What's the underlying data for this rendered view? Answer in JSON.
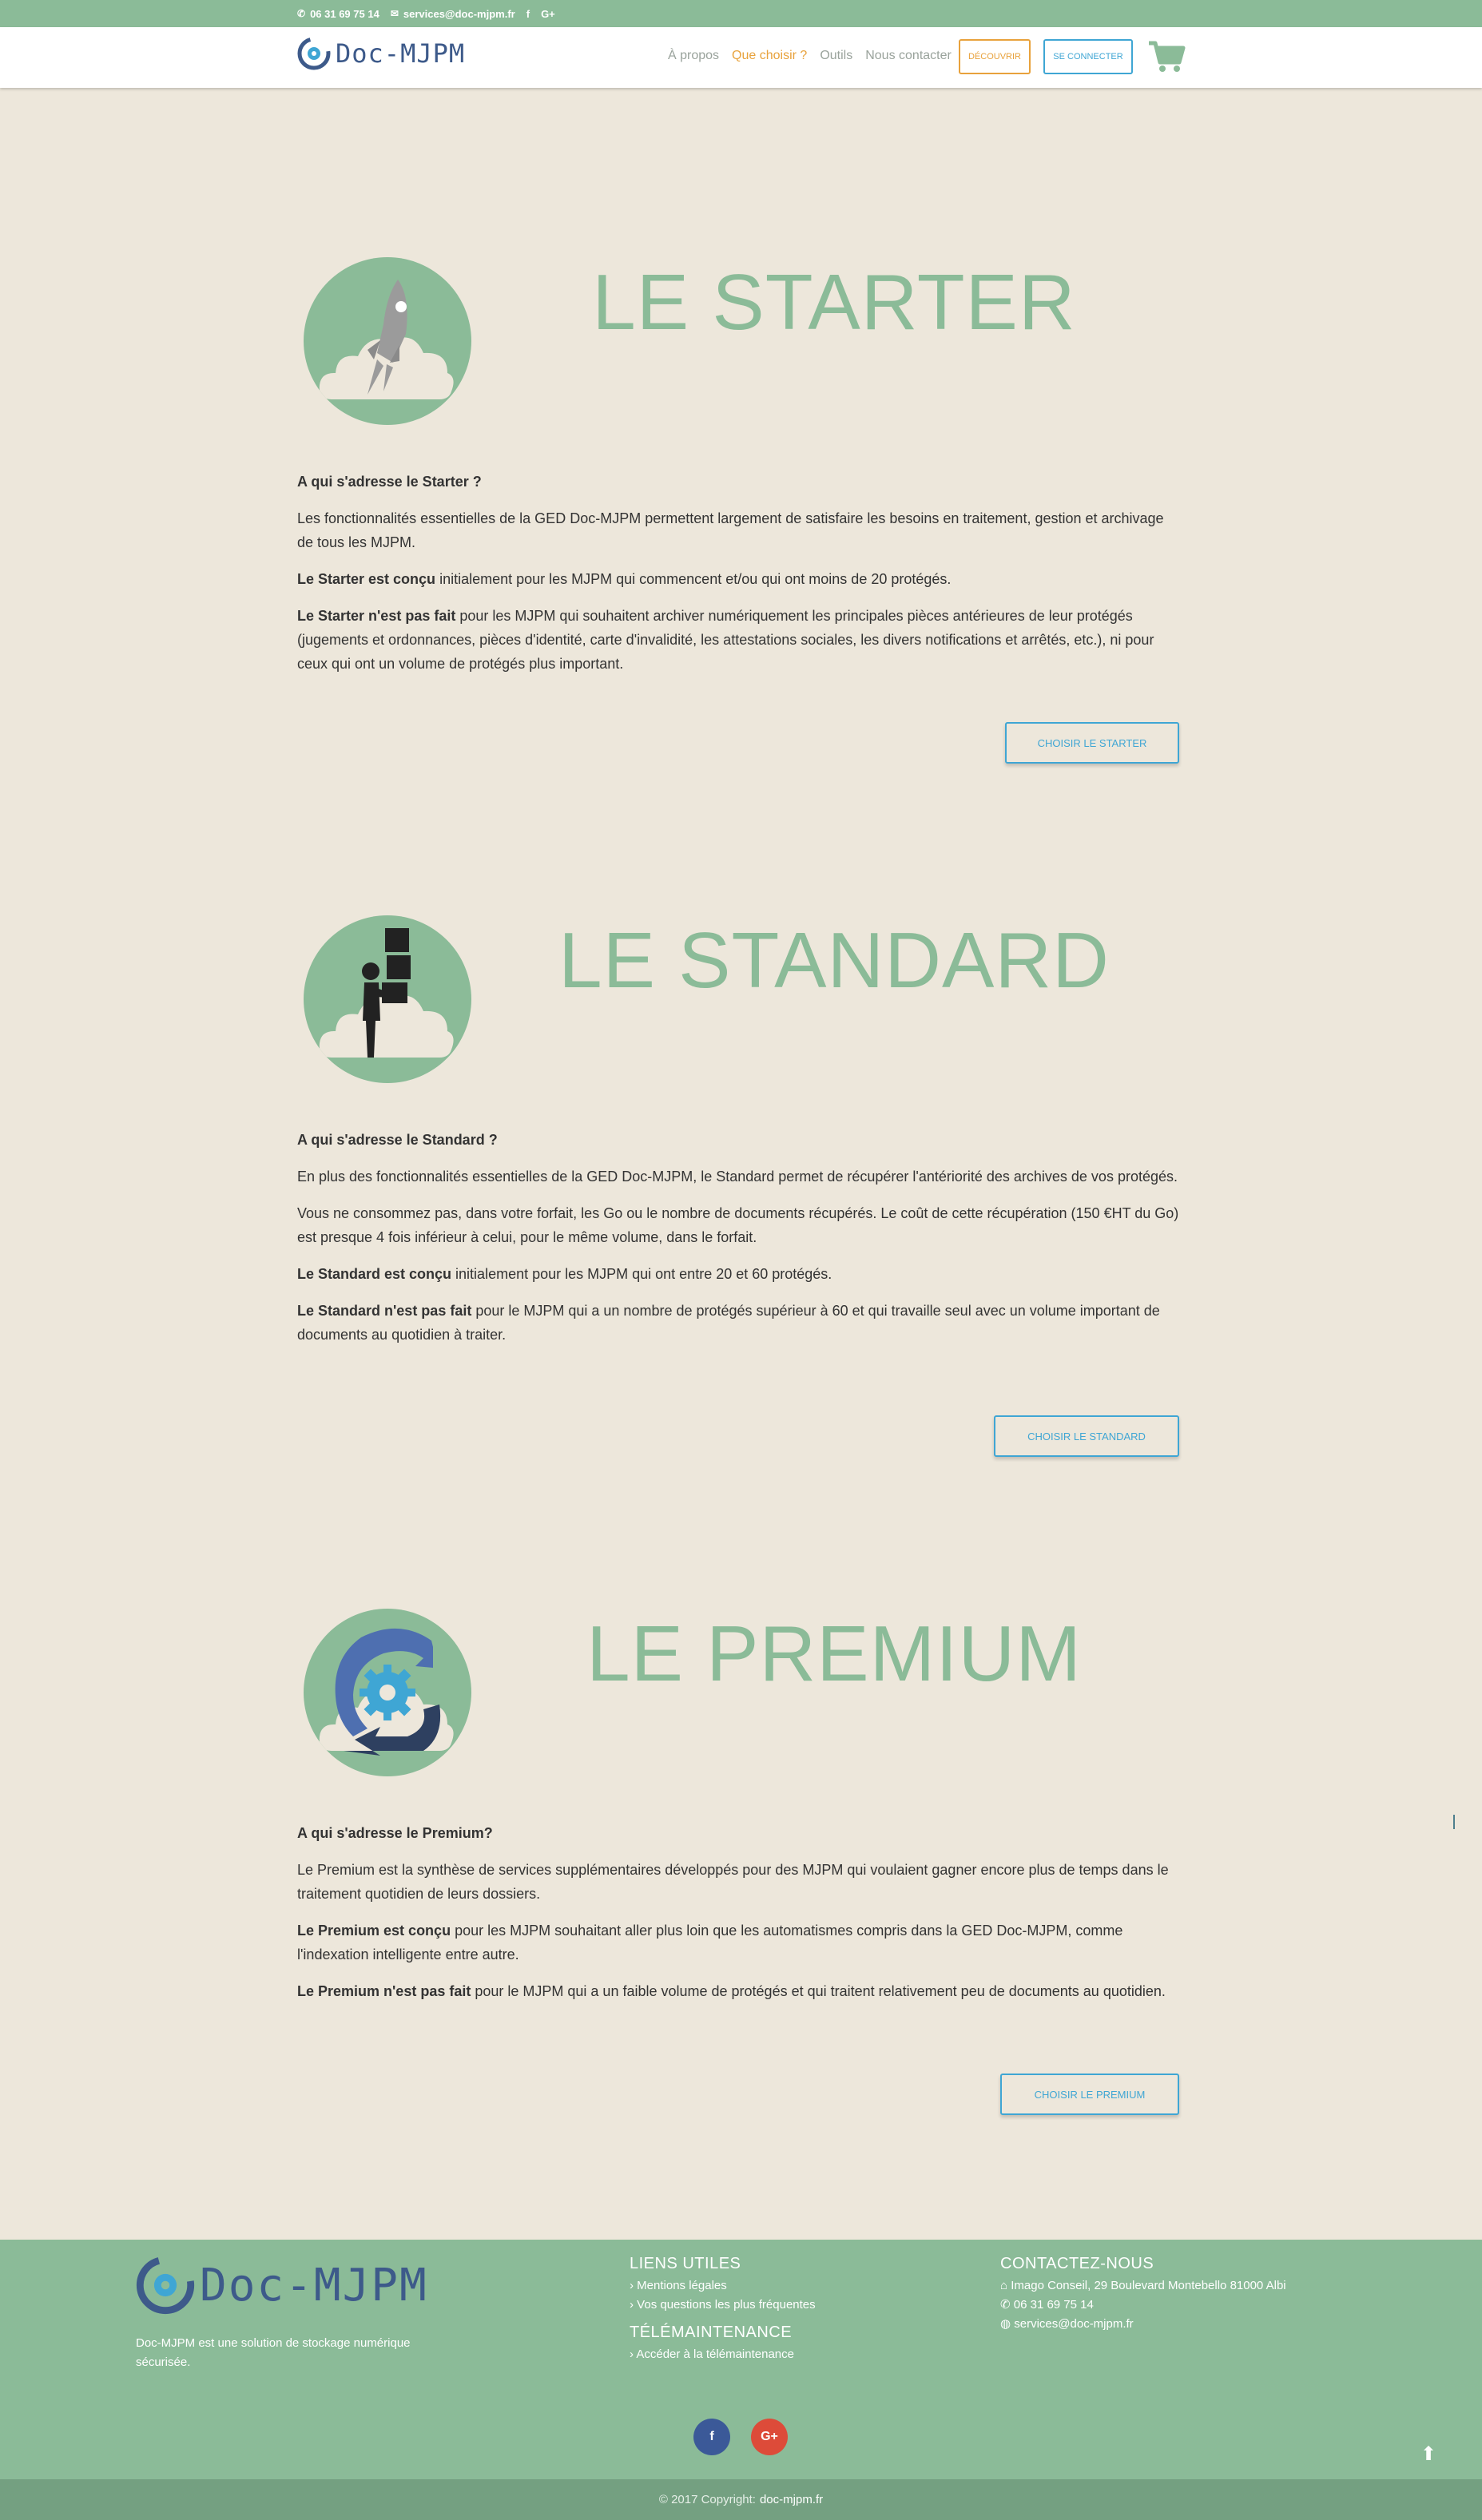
{
  "topbar": {
    "phone": "06 31 69 75 14",
    "email": "services@doc-mjpm.fr",
    "facebook": "f",
    "googleplus": "G+"
  },
  "nav": {
    "logo": "Doc-MJPM",
    "links": [
      "À propos",
      "Que choisir ?",
      "Outils",
      "Nous contacter"
    ],
    "active_index": 1,
    "discover": "DÉCOUVRIR",
    "connect": "SE CONNECTER"
  },
  "plans": [
    {
      "title": "LE STARTER",
      "icon": "rocket-cloud-icon",
      "question": "A qui s'adresse le Starter ?",
      "p1": "Les fonctionnalités essentielles de la GED Doc-MJPM permettent largement de satisfaire les besoins en traitement, gestion et archivage de tous les MJPM.",
      "p2_bold": "Le Starter est conçu",
      "p2_rest": " initialement pour les MJPM qui commencent et/ou qui ont moins de 20 protégés.",
      "p3_bold": "Le Starter n'est pas fait",
      "p3_rest": " pour les MJPM qui souhaitent archiver numériquement les principales pièces antérieures de leur protégés (jugements et ordonnances, pièces d'identité, carte d'invalidité, les attestations sociales, les divers notifications et arrêtés, etc.), ni pour ceux qui ont un volume de protégés plus important.",
      "button": "CHOISIR LE STARTER"
    },
    {
      "title": "LE STANDARD",
      "icon": "person-boxes-cloud-icon",
      "question": "A qui s'adresse le Standard ?",
      "p1": "En plus des fonctionnalités essentielles de la GED Doc-MJPM, le Standard permet de récupérer l'antériorité des archives de vos protégés.",
      "p2": "Vous ne consommez pas, dans votre forfait, les Go ou le nombre de documents récupérés. Le coût de cette récupération (150 €HT du Go) est presque 4 fois inférieur à celui, pour le même volume, dans le forfait.",
      "p3_bold": "Le Standard est conçu",
      "p3_rest": " initialement pour les MJPM qui ont entre 20 et 60 protégés.",
      "p4_bold": "Le Standard n'est pas fait",
      "p4_rest": " pour le MJPM qui a un nombre de protégés supérieur à 60 et qui travaille seul avec un volume important de documents au quotidien à traiter.",
      "button": "CHOISIR LE STANDARD"
    },
    {
      "title": "LE PREMIUM",
      "icon": "gear-sync-cloud-icon",
      "question": "A qui s'adresse le Premium?",
      "p1": "Le Premium est la synthèse de services supplémentaires développés pour des MJPM qui voulaient gagner encore plus de temps dans le traitement quotidien de leurs dossiers.",
      "p2_bold": "Le Premium est conçu",
      "p2_rest": " pour les MJPM souhaitant aller plus loin que les automatismes compris dans la GED Doc-MJPM, comme l'indexation intelligente entre autre.",
      "p3_bold": "Le Premium n'est pas fait",
      "p3_rest": " pour le MJPM qui a un faible volume de protégés et qui traitent relativement peu de documents au quotidien.",
      "button": "CHOISIR LE PREMIUM"
    }
  ],
  "footer": {
    "logo": "Doc-MJPM",
    "description": "Doc-MJPM est une solution de stockage numérique sécurisée.",
    "links_title": "LIENS UTILES",
    "links": [
      "Mentions légales",
      "Vos questions les plus fréquentes"
    ],
    "tele_title": "TÉLÉMAINTENANCE",
    "tele_link": "Accéder à la télémaintenance",
    "contact_title": "CONTACTEZ-NOUS",
    "address": "Imago Conseil, 29 Boulevard Montebello 81000 Albi",
    "phone": "06 31 69 75 14",
    "email": "services@doc-mjpm.fr",
    "facebook": "f",
    "googleplus": "G+",
    "copyright_prefix": "© 2017 Copyright:",
    "copyright_site": "doc-mjpm.fr"
  },
  "colors": {
    "accent_green": "#8bbb98",
    "accent_orange": "#e8a23c",
    "accent_blue": "#3fa6d4",
    "logo_blue": "#3d5a8a",
    "background": "#ede7db"
  }
}
